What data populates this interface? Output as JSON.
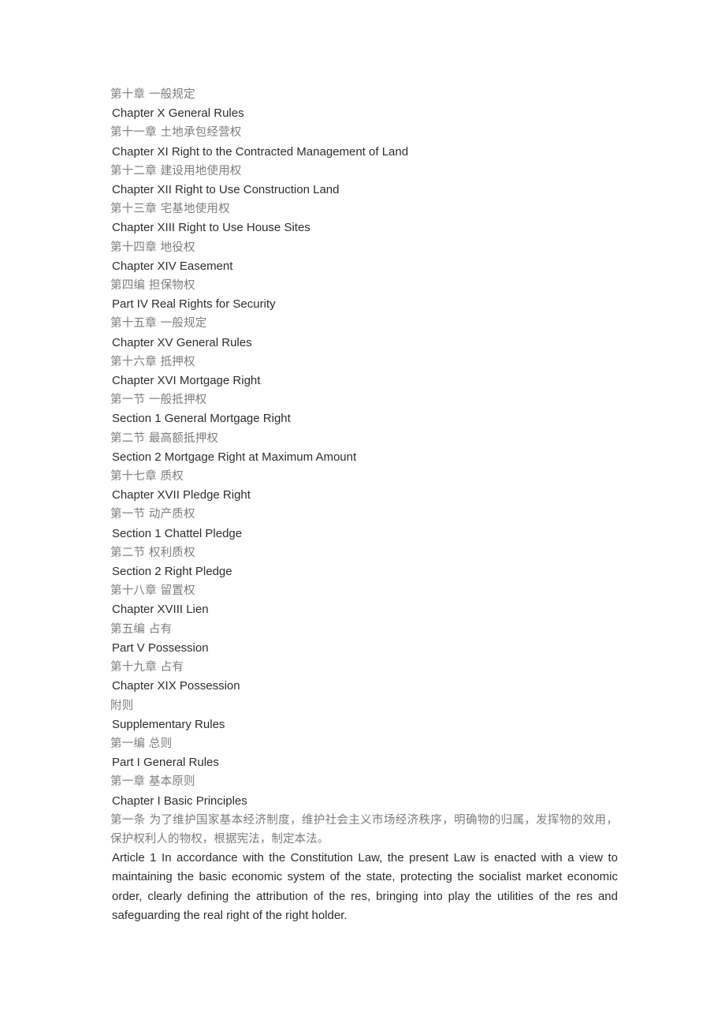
{
  "document": {
    "language_pair": "zh-en",
    "body_text_color": "#2e2e2e",
    "secondary_text_color": "#7d7d7d",
    "background_color": "#ffffff"
  },
  "toc_lines": [
    {
      "lang": "zh",
      "text": "第十章  一般规定"
    },
    {
      "lang": "en",
      "text": "Chapter X General Rules"
    },
    {
      "lang": "zh",
      "text": "第十一章  土地承包经营权"
    },
    {
      "lang": "en",
      "text": "Chapter XI Right to the Contracted Management of Land"
    },
    {
      "lang": "zh",
      "text": "第十二章  建设用地使用权"
    },
    {
      "lang": "en",
      "text": "Chapter XII Right to Use Construction Land"
    },
    {
      "lang": "zh",
      "text": "第十三章  宅基地使用权"
    },
    {
      "lang": "en",
      "text": "Chapter XIII Right to Use House Sites"
    },
    {
      "lang": "zh",
      "text": "第十四章  地役权"
    },
    {
      "lang": "en",
      "text": "Chapter XIV Easement"
    },
    {
      "lang": "zh",
      "text": "第四编  担保物权"
    },
    {
      "lang": "en",
      "text": "Part IV Real Rights for Security"
    },
    {
      "lang": "zh",
      "text": "第十五章  一般规定"
    },
    {
      "lang": "en",
      "text": "Chapter XV General Rules"
    },
    {
      "lang": "zh",
      "text": "第十六章  抵押权"
    },
    {
      "lang": "en",
      "text": "Chapter XVI Mortgage Right"
    },
    {
      "lang": "zh",
      "text": "第一节  一般抵押权"
    },
    {
      "lang": "en",
      "text": "Section 1 General Mortgage Right"
    },
    {
      "lang": "zh",
      "text": "第二节  最高额抵押权"
    },
    {
      "lang": "en",
      "text": "Section 2 Mortgage Right at Maximum Amount"
    },
    {
      "lang": "zh",
      "text": "第十七章  质权"
    },
    {
      "lang": "en",
      "text": "Chapter XVII Pledge Right"
    },
    {
      "lang": "zh",
      "text": "第一节  动产质权"
    },
    {
      "lang": "en",
      "text": "Section 1 Chattel Pledge"
    },
    {
      "lang": "zh",
      "text": "第二节  权利质权"
    },
    {
      "lang": "en",
      "text": "Section 2 Right Pledge"
    },
    {
      "lang": "zh",
      "text": "第十八章  留置权"
    },
    {
      "lang": "en",
      "text": "Chapter XVIII Lien"
    },
    {
      "lang": "zh",
      "text": "第五编  占有"
    },
    {
      "lang": "en",
      "text": "Part V Possession"
    },
    {
      "lang": "zh",
      "text": "第十九章  占有"
    },
    {
      "lang": "en",
      "text": "Chapter XIX Possession"
    },
    {
      "lang": "zh",
      "text": "附则"
    },
    {
      "lang": "en",
      "text": "Supplementary Rules"
    },
    {
      "lang": "zh",
      "text": "第一编  总则"
    },
    {
      "lang": "en",
      "text": "Part I General Rules"
    },
    {
      "lang": "zh",
      "text": "第一章  基本原则"
    },
    {
      "lang": "en",
      "text": "Chapter I Basic Principles"
    }
  ],
  "article_1": {
    "zh": " 第一条  为了维护国家基本经济制度，维护社会主义市场经济秩序，明确物的归属，发挥物的效用，保护权利人的物权，根据宪法，制定本法。",
    "en": " Article 1 In accordance with the Constitution Law, the present Law is enacted with a view to maintaining the basic economic system of the state, protecting the socialist market economic order, clearly defining the attribution of the res, bringing into play the utilities of the res and safeguarding the real right of the right holder."
  }
}
